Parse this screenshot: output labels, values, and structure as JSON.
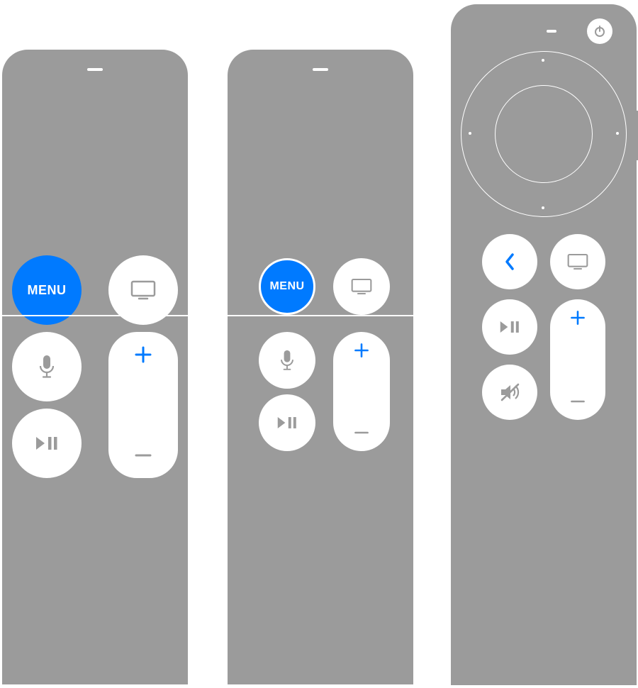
{
  "colors": {
    "remote_body": "#9b9b9b",
    "button_white": "#ffffff",
    "accent_blue": "#007aff",
    "icon_gray": "#9b9b9b"
  },
  "remotes": [
    {
      "id": "siri-remote-1st-gen",
      "menu_label": "MENU",
      "menu_highlighted": true,
      "buttons": [
        "menu",
        "tv",
        "mic",
        "play-pause",
        "volume-up",
        "volume-down"
      ]
    },
    {
      "id": "siri-remote-1st-gen-small",
      "menu_label": "MENU",
      "menu_highlighted": true,
      "buttons": [
        "menu",
        "tv",
        "mic",
        "play-pause",
        "volume-up",
        "volume-down"
      ]
    },
    {
      "id": "siri-remote-2nd-gen",
      "buttons": [
        "power",
        "clickpad",
        "back",
        "tv",
        "play-pause",
        "mute",
        "volume-up",
        "volume-down"
      ]
    }
  ]
}
